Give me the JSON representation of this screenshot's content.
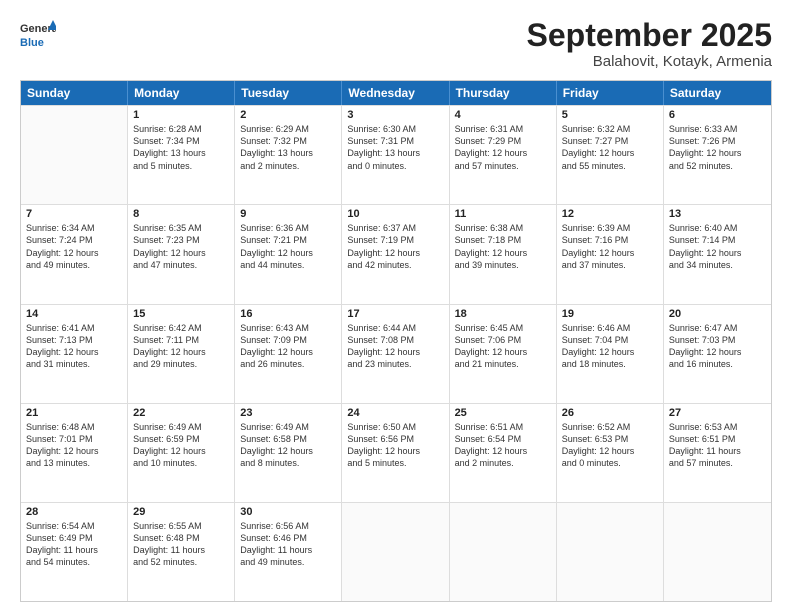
{
  "logo": {
    "general": "General",
    "blue": "Blue"
  },
  "header": {
    "month": "September 2025",
    "location": "Balahovit, Kotayk, Armenia"
  },
  "days": [
    "Sunday",
    "Monday",
    "Tuesday",
    "Wednesday",
    "Thursday",
    "Friday",
    "Saturday"
  ],
  "rows": [
    [
      {
        "day": null,
        "data": null
      },
      {
        "day": "1",
        "data": [
          "Sunrise: 6:28 AM",
          "Sunset: 7:34 PM",
          "Daylight: 13 hours",
          "and 5 minutes."
        ]
      },
      {
        "day": "2",
        "data": [
          "Sunrise: 6:29 AM",
          "Sunset: 7:32 PM",
          "Daylight: 13 hours",
          "and 2 minutes."
        ]
      },
      {
        "day": "3",
        "data": [
          "Sunrise: 6:30 AM",
          "Sunset: 7:31 PM",
          "Daylight: 13 hours",
          "and 0 minutes."
        ]
      },
      {
        "day": "4",
        "data": [
          "Sunrise: 6:31 AM",
          "Sunset: 7:29 PM",
          "Daylight: 12 hours",
          "and 57 minutes."
        ]
      },
      {
        "day": "5",
        "data": [
          "Sunrise: 6:32 AM",
          "Sunset: 7:27 PM",
          "Daylight: 12 hours",
          "and 55 minutes."
        ]
      },
      {
        "day": "6",
        "data": [
          "Sunrise: 6:33 AM",
          "Sunset: 7:26 PM",
          "Daylight: 12 hours",
          "and 52 minutes."
        ]
      }
    ],
    [
      {
        "day": "7",
        "data": [
          "Sunrise: 6:34 AM",
          "Sunset: 7:24 PM",
          "Daylight: 12 hours",
          "and 49 minutes."
        ]
      },
      {
        "day": "8",
        "data": [
          "Sunrise: 6:35 AM",
          "Sunset: 7:23 PM",
          "Daylight: 12 hours",
          "and 47 minutes."
        ]
      },
      {
        "day": "9",
        "data": [
          "Sunrise: 6:36 AM",
          "Sunset: 7:21 PM",
          "Daylight: 12 hours",
          "and 44 minutes."
        ]
      },
      {
        "day": "10",
        "data": [
          "Sunrise: 6:37 AM",
          "Sunset: 7:19 PM",
          "Daylight: 12 hours",
          "and 42 minutes."
        ]
      },
      {
        "day": "11",
        "data": [
          "Sunrise: 6:38 AM",
          "Sunset: 7:18 PM",
          "Daylight: 12 hours",
          "and 39 minutes."
        ]
      },
      {
        "day": "12",
        "data": [
          "Sunrise: 6:39 AM",
          "Sunset: 7:16 PM",
          "Daylight: 12 hours",
          "and 37 minutes."
        ]
      },
      {
        "day": "13",
        "data": [
          "Sunrise: 6:40 AM",
          "Sunset: 7:14 PM",
          "Daylight: 12 hours",
          "and 34 minutes."
        ]
      }
    ],
    [
      {
        "day": "14",
        "data": [
          "Sunrise: 6:41 AM",
          "Sunset: 7:13 PM",
          "Daylight: 12 hours",
          "and 31 minutes."
        ]
      },
      {
        "day": "15",
        "data": [
          "Sunrise: 6:42 AM",
          "Sunset: 7:11 PM",
          "Daylight: 12 hours",
          "and 29 minutes."
        ]
      },
      {
        "day": "16",
        "data": [
          "Sunrise: 6:43 AM",
          "Sunset: 7:09 PM",
          "Daylight: 12 hours",
          "and 26 minutes."
        ]
      },
      {
        "day": "17",
        "data": [
          "Sunrise: 6:44 AM",
          "Sunset: 7:08 PM",
          "Daylight: 12 hours",
          "and 23 minutes."
        ]
      },
      {
        "day": "18",
        "data": [
          "Sunrise: 6:45 AM",
          "Sunset: 7:06 PM",
          "Daylight: 12 hours",
          "and 21 minutes."
        ]
      },
      {
        "day": "19",
        "data": [
          "Sunrise: 6:46 AM",
          "Sunset: 7:04 PM",
          "Daylight: 12 hours",
          "and 18 minutes."
        ]
      },
      {
        "day": "20",
        "data": [
          "Sunrise: 6:47 AM",
          "Sunset: 7:03 PM",
          "Daylight: 12 hours",
          "and 16 minutes."
        ]
      }
    ],
    [
      {
        "day": "21",
        "data": [
          "Sunrise: 6:48 AM",
          "Sunset: 7:01 PM",
          "Daylight: 12 hours",
          "and 13 minutes."
        ]
      },
      {
        "day": "22",
        "data": [
          "Sunrise: 6:49 AM",
          "Sunset: 6:59 PM",
          "Daylight: 12 hours",
          "and 10 minutes."
        ]
      },
      {
        "day": "23",
        "data": [
          "Sunrise: 6:49 AM",
          "Sunset: 6:58 PM",
          "Daylight: 12 hours",
          "and 8 minutes."
        ]
      },
      {
        "day": "24",
        "data": [
          "Sunrise: 6:50 AM",
          "Sunset: 6:56 PM",
          "Daylight: 12 hours",
          "and 5 minutes."
        ]
      },
      {
        "day": "25",
        "data": [
          "Sunrise: 6:51 AM",
          "Sunset: 6:54 PM",
          "Daylight: 12 hours",
          "and 2 minutes."
        ]
      },
      {
        "day": "26",
        "data": [
          "Sunrise: 6:52 AM",
          "Sunset: 6:53 PM",
          "Daylight: 12 hours",
          "and 0 minutes."
        ]
      },
      {
        "day": "27",
        "data": [
          "Sunrise: 6:53 AM",
          "Sunset: 6:51 PM",
          "Daylight: 11 hours",
          "and 57 minutes."
        ]
      }
    ],
    [
      {
        "day": "28",
        "data": [
          "Sunrise: 6:54 AM",
          "Sunset: 6:49 PM",
          "Daylight: 11 hours",
          "and 54 minutes."
        ]
      },
      {
        "day": "29",
        "data": [
          "Sunrise: 6:55 AM",
          "Sunset: 6:48 PM",
          "Daylight: 11 hours",
          "and 52 minutes."
        ]
      },
      {
        "day": "30",
        "data": [
          "Sunrise: 6:56 AM",
          "Sunset: 6:46 PM",
          "Daylight: 11 hours",
          "and 49 minutes."
        ]
      },
      {
        "day": null,
        "data": null
      },
      {
        "day": null,
        "data": null
      },
      {
        "day": null,
        "data": null
      },
      {
        "day": null,
        "data": null
      }
    ]
  ]
}
